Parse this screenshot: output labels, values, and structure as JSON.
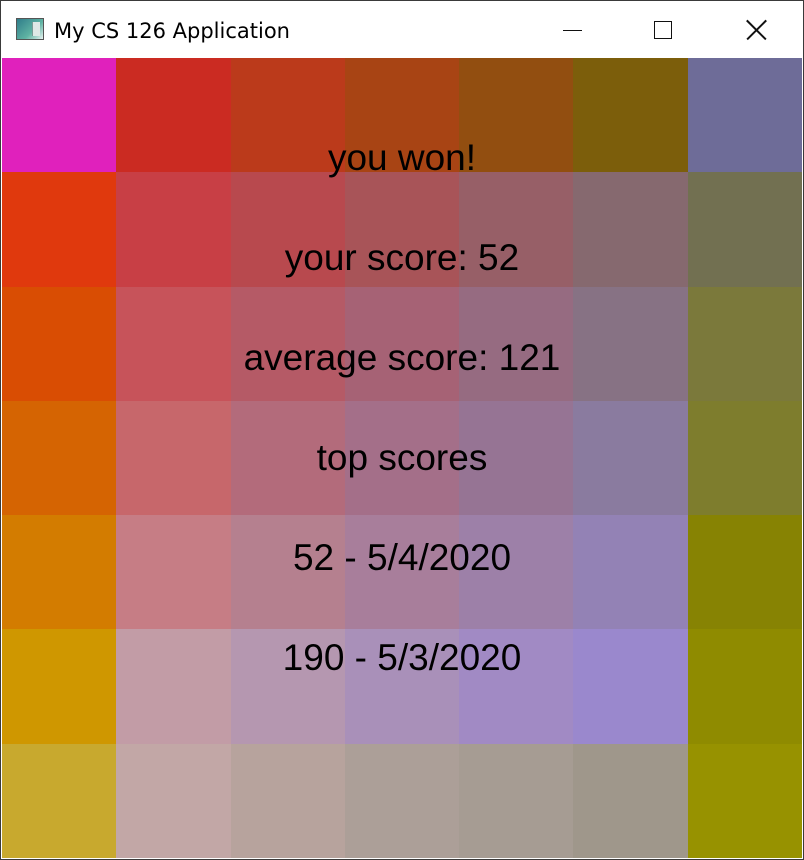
{
  "window": {
    "title": "My CS 126 Application",
    "app_icon": "application-icon",
    "controls": {
      "minimize": "minimize-icon",
      "maximize": "maximize-icon",
      "close": "close-icon"
    }
  },
  "board": {
    "rows": 7,
    "cols": 7,
    "colors": [
      [
        "#e021bc",
        "#cb2b22",
        "#bb3a1b",
        "#a84414",
        "#924e10",
        "#7c5e0b",
        "#6e6c98"
      ],
      [
        "#e0390d",
        "#c83f45",
        "#b8494e",
        "#a85458",
        "#975f67",
        "#86696f",
        "#727051"
      ],
      [
        "#d94d03",
        "#c7535a",
        "#b55a66",
        "#a66275",
        "#966b81",
        "#877284",
        "#7b793b"
      ],
      [
        "#d56402",
        "#c7676b",
        "#b36b7b",
        "#a46f89",
        "#967494",
        "#8a7b9f",
        "#7e7d2d"
      ],
      [
        "#d37c00",
        "#c67d85",
        "#b5808f",
        "#a87e9b",
        "#9d80a8",
        "#9382b5",
        "#878303"
      ],
      [
        "#cf9700",
        "#c29ca6",
        "#b597b0",
        "#a990b9",
        "#a18ac4",
        "#9a88cd",
        "#8f8b00"
      ],
      [
        "#c8a92e",
        "#c2a7a6",
        "#b7a39d",
        "#ac9f98",
        "#a69c93",
        "#9f978b",
        "#979200"
      ]
    ]
  },
  "results": {
    "outcome": "you won!",
    "your_score": "your score: 52",
    "average_score": "average score: 121",
    "top_scores_heading": "top scores",
    "top_scores": [
      "52 - 5/4/2020",
      "190 - 5/3/2020"
    ]
  }
}
